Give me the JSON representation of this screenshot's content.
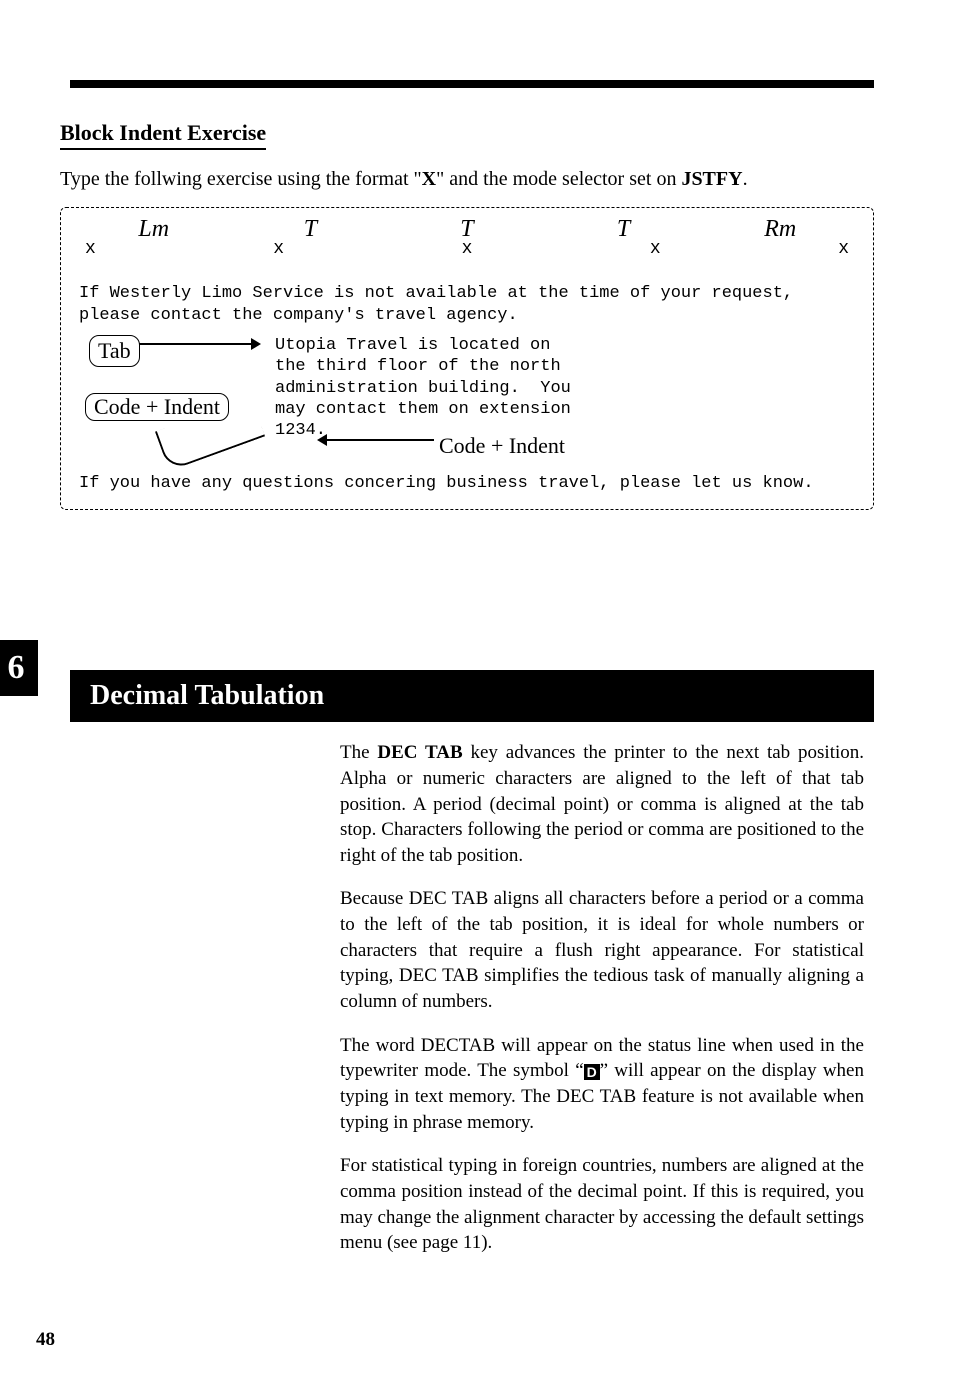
{
  "page_number": "48",
  "chapter_number": "6",
  "exercise": {
    "title": "Block Indent Exercise",
    "intro_pre": "Type the follwing exercise using the format \"",
    "intro_x": "X",
    "intro_mid": "\" and the mode selector set on ",
    "intro_bold": "JSTFY",
    "intro_end": "."
  },
  "ruler": {
    "labels": [
      "Lm",
      "T",
      "T",
      "T",
      "Rm"
    ],
    "marks": [
      "x",
      "x",
      "x",
      "x",
      "x"
    ]
  },
  "sample": {
    "para1": "If Westerly Limo Service is not available at the time of your request, please contact the company's travel agency.",
    "tab_label": "Tab",
    "code_indent_label": "Code + Indent",
    "indented": "Utopia Travel is located on\nthe third floor of the north\nadministration building.  You\nmay contact them on extension\n1234.",
    "code_indent_right": "Code + Indent",
    "para2": "If you have any questions concering business travel, please let us know."
  },
  "section": {
    "title": "Decimal Tabulation",
    "p1_pre": "The ",
    "p1_bold": "DEC TAB",
    "p1_rest": " key advances the printer to the next tab position. Alpha or numeric characters are aligned to the left of that tab position. A period (decimal point) or comma is aligned at the tab stop. Characters following the period or comma are positioned to the right of the tab position.",
    "p2": "Because DEC TAB aligns all characters before a period or a comma to the left of the tab position, it is ideal for whole numbers or characters that require a flush right appearance. For statistical typing, DEC TAB simplifies the tedious task of manually aligning a column of numbers.",
    "p3_pre": "The word DECTAB will appear on the status line when used in the typewriter mode. The symbol “",
    "p3_symbol": "D",
    "p3_post": "” will appear on the display when typing in text memory. The DEC TAB feature is not available when typing in phrase memory.",
    "p4": "For statistical typing in foreign countries, numbers are aligned at the comma position instead of the decimal point. If this is required, you may change the alignment character by accessing the default settings menu (see page 11)."
  }
}
